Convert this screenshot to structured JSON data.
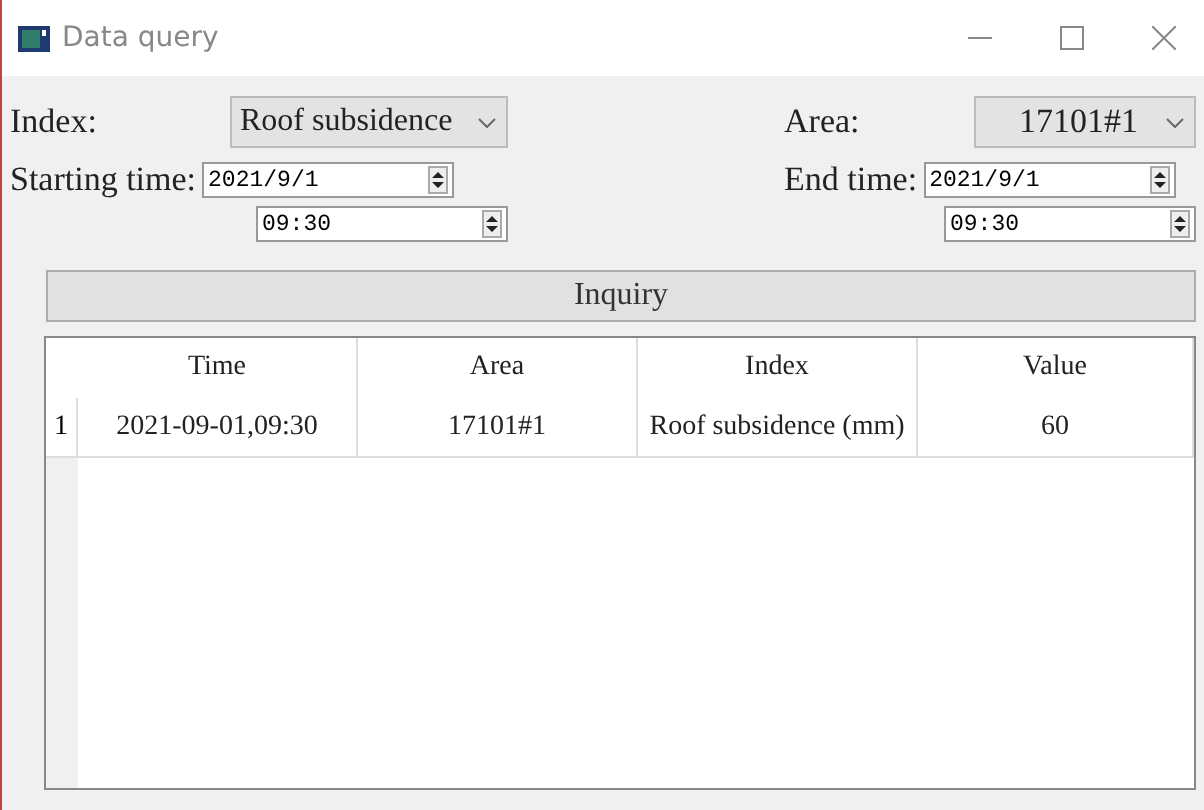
{
  "window": {
    "title": "Data query"
  },
  "index": {
    "label": "Index:",
    "value": "Roof subsidence"
  },
  "area": {
    "label": "Area:",
    "value": "17101#1"
  },
  "start": {
    "label": "Starting time:",
    "date": "2021/9/1",
    "time": "09:30"
  },
  "end": {
    "label": "End time:",
    "date": "2021/9/1",
    "time": "09:30"
  },
  "inquiry_button": "Inquiry",
  "table": {
    "columns": [
      "Time",
      "Area",
      "Index",
      "Value"
    ],
    "rows": [
      {
        "number": "1",
        "cells": [
          "2021-09-01,09:30",
          "17101#1",
          "Roof subsidence (mm)",
          "60"
        ]
      }
    ]
  }
}
